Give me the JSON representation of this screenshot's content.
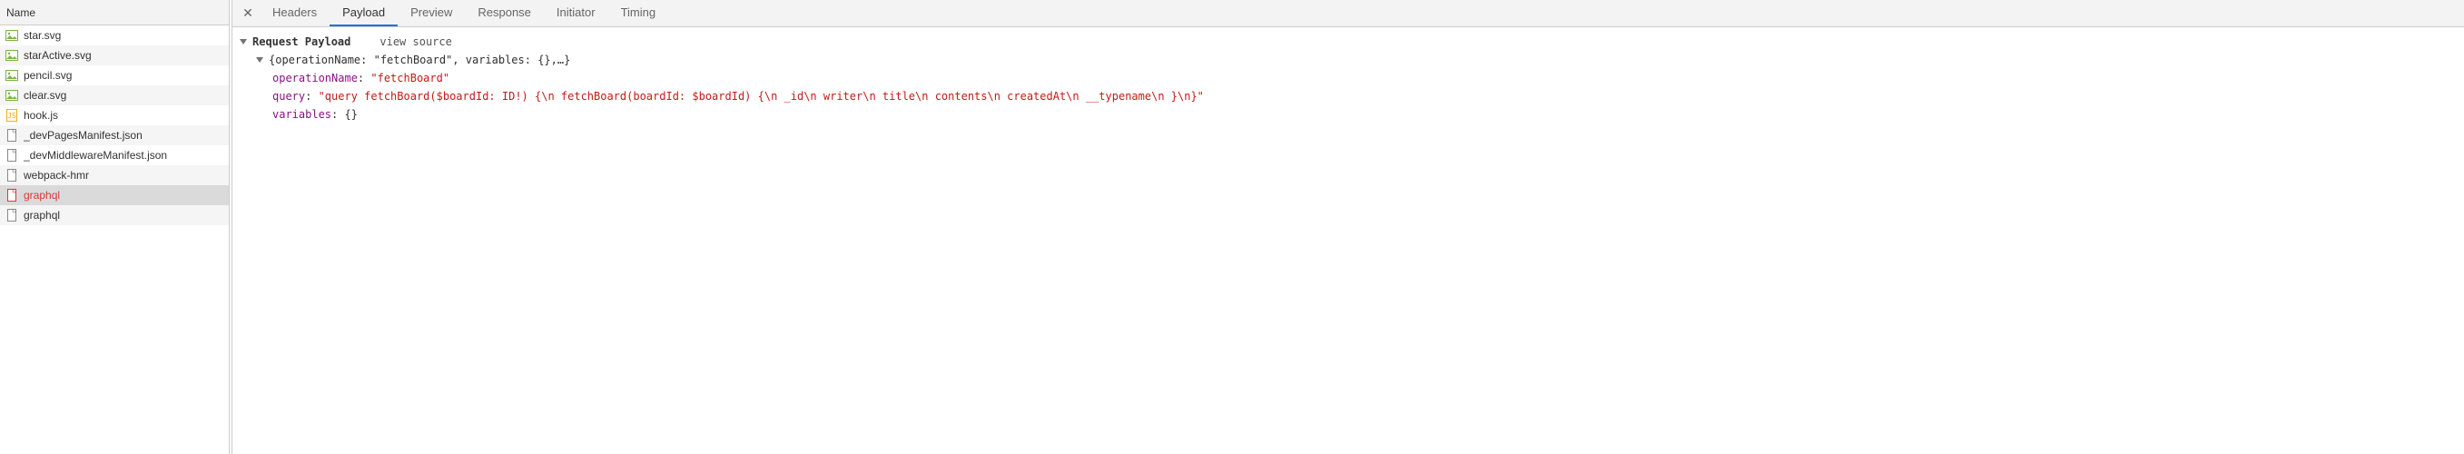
{
  "network": {
    "header": "Name",
    "items": [
      {
        "name": "star.svg",
        "type": "image",
        "error": false
      },
      {
        "name": "starActive.svg",
        "type": "image",
        "error": false
      },
      {
        "name": "pencil.svg",
        "type": "image",
        "error": false
      },
      {
        "name": "clear.svg",
        "type": "image",
        "error": false
      },
      {
        "name": "hook.js",
        "type": "script",
        "error": false
      },
      {
        "name": "_devPagesManifest.json",
        "type": "doc",
        "error": false
      },
      {
        "name": "_devMiddlewareManifest.json",
        "type": "doc",
        "error": false
      },
      {
        "name": "webpack-hmr",
        "type": "doc",
        "error": false
      },
      {
        "name": "graphql",
        "type": "doc",
        "error": true,
        "selected": true
      },
      {
        "name": "graphql",
        "type": "doc",
        "error": false
      }
    ]
  },
  "tabs": {
    "items": [
      "Headers",
      "Payload",
      "Preview",
      "Response",
      "Initiator",
      "Timing"
    ],
    "active": 1
  },
  "payload": {
    "section_title": "Request Payload",
    "view_source": "view source",
    "summary": "{operationName: \"fetchBoard\", variables: {},…}",
    "props": {
      "operationName_key": "operationName",
      "operationName_val": "\"fetchBoard\"",
      "query_key": "query",
      "query_val": "\"query fetchBoard($boardId: ID!) {\\n  fetchBoard(boardId: $boardId) {\\n    _id\\n    writer\\n    title\\n    contents\\n    createdAt\\n    __typename\\n  }\\n}\"",
      "variables_key": "variables",
      "variables_val": "{}"
    }
  }
}
